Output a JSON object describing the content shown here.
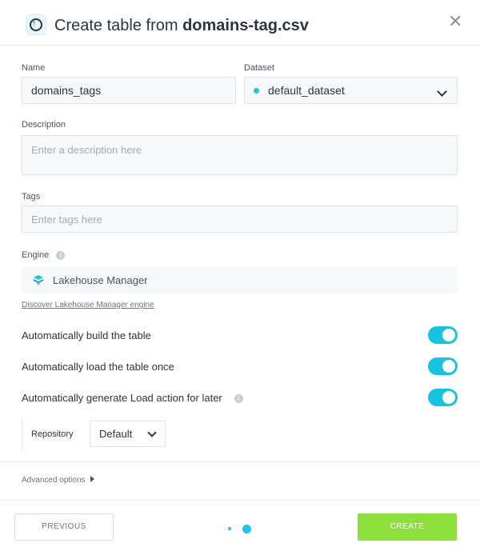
{
  "header": {
    "title_prefix": "Create table from ",
    "title_file": "domains-tag.csv",
    "close_glyph": "✕",
    "logo_icon": "upload-icon"
  },
  "form": {
    "name_label": "Name",
    "name_value": "domains_tags",
    "dataset_label": "Dataset",
    "dataset_value": "default_dataset",
    "description_label": "Description",
    "description_placeholder": "Enter a description here",
    "tags_label": "Tags",
    "tags_placeholder": "Enter tags here",
    "engine_label": "Engine",
    "engine_value": "Lakehouse Manager",
    "engine_link": "Discover Lakehouse Manager engine"
  },
  "toggles": [
    {
      "label": "Automatically build the table",
      "on": true
    },
    {
      "label": "Automatically load the table once",
      "on": true
    },
    {
      "label": "Automatically generate Load action for later",
      "on": true
    }
  ],
  "repository": {
    "label": "Repository",
    "value": "Default"
  },
  "advanced_label": "Advanced options",
  "footer": {
    "previous_label": "PREVIOUS",
    "create_label": "CREATE",
    "current_step": 2,
    "total_steps": 2
  },
  "colors": {
    "accent": "#1ec4e4",
    "create_button": "#8ddf3c"
  }
}
